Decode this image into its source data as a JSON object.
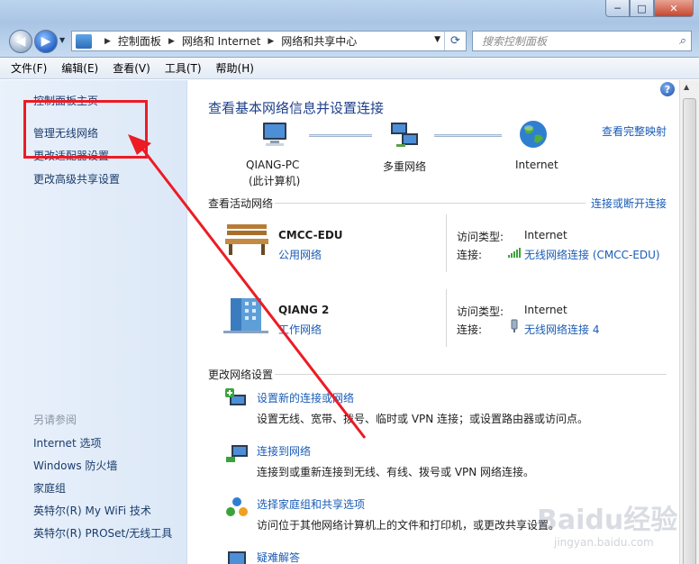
{
  "window": {
    "minimize": "─",
    "maximize": "□",
    "close": "✕"
  },
  "address": {
    "crumbs": [
      "控制面板",
      "网络和 Internet",
      "网络和共享中心"
    ]
  },
  "search": {
    "placeholder": "搜索控制面板"
  },
  "menu": [
    "文件(F)",
    "编辑(E)",
    "查看(V)",
    "工具(T)",
    "帮助(H)"
  ],
  "sidebar": {
    "home": "控制面板主页",
    "items": [
      "管理无线网络",
      "更改适配器设置",
      "更改高级共享设置"
    ],
    "see_also_title": "另请参阅",
    "see_also": [
      "Internet 选项",
      "Windows 防火墙",
      "家庭组",
      "英特尔(R) My WiFi 技术",
      "英特尔(R) PROSet/无线工具"
    ]
  },
  "main": {
    "title": "查看基本网络信息并设置连接",
    "full_map_link": "查看完整映射",
    "map": {
      "pc_name": "QIANG-PC",
      "pc_sub": "(此计算机)",
      "middle": "多重网络",
      "internet": "Internet"
    },
    "active_title": "查看活动网络",
    "connect_link": "连接或断开连接",
    "networks": [
      {
        "name": "CMCC-EDU",
        "type_link": "公用网络",
        "access_label": "访问类型:",
        "access_value": "Internet",
        "conn_label": "连接:",
        "conn_value": "无线网络连接 (CMCC-EDU)"
      },
      {
        "name": "QIANG  2",
        "type_link": "工作网络",
        "access_label": "访问类型:",
        "access_value": "Internet",
        "conn_label": "连接:",
        "conn_value": "无线网络连接 4"
      }
    ],
    "change_title": "更改网络设置",
    "tasks": [
      {
        "link": "设置新的连接或网络",
        "desc": "设置无线、宽带、拨号、临时或 VPN 连接；或设置路由器或访问点。"
      },
      {
        "link": "连接到网络",
        "desc": "连接到或重新连接到无线、有线、拨号或 VPN 网络连接。"
      },
      {
        "link": "选择家庭组和共享选项",
        "desc": "访问位于其他网络计算机上的文件和打印机，或更改共享设置。"
      },
      {
        "link": "疑难解答",
        "desc": ""
      }
    ]
  },
  "watermark": {
    "brand": "Baidu经验",
    "url": "jingyan.baidu.com"
  },
  "colors": {
    "accent_link": "#1a5cb5",
    "annotation": "#ec1c24"
  }
}
